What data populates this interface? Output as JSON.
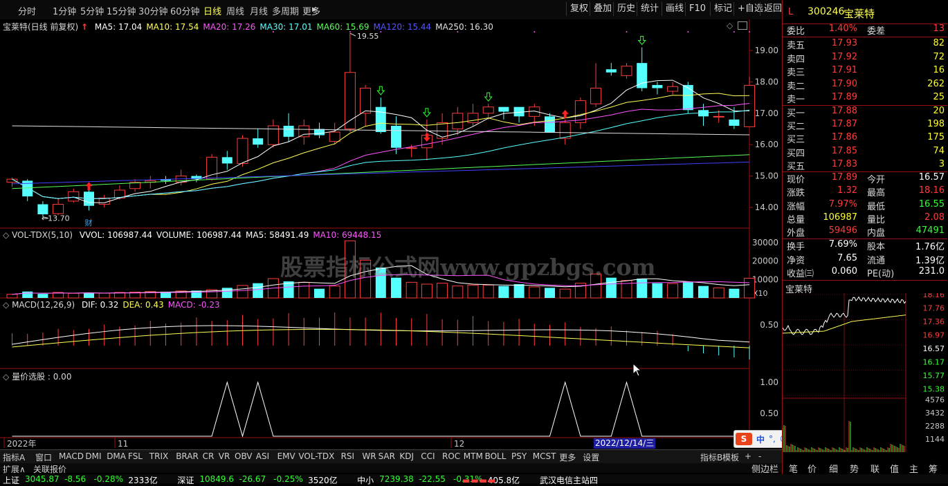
{
  "periods": [
    "分时",
    "1分钟",
    "5分钟",
    "15分钟",
    "30分钟",
    "60分钟",
    "日线",
    "周线",
    "月线",
    "多周期",
    "更多"
  ],
  "active_period": "日线",
  "toolbar_right": [
    "复权",
    "叠加",
    "历史",
    "统计",
    "画线",
    "F10",
    "标记",
    "+自选",
    "返回"
  ],
  "stock": {
    "code": "300246",
    "name": "宝莱特",
    "prefix": "L"
  },
  "ma_line": {
    "title": "宝莱特(日线 前复权)",
    "items": [
      {
        "label": "MA5: 17.04",
        "color": "#ffffff"
      },
      {
        "label": "MA10: 17.54",
        "color": "#ffff55"
      },
      {
        "label": "MA20: 17.26",
        "color": "#ff55ff"
      },
      {
        "label": "MA30: 17.01",
        "color": "#55ffff"
      },
      {
        "label": "MA60: 15.69",
        "color": "#55ff55"
      },
      {
        "label": "MA120: 15.44",
        "color": "#5555ff"
      },
      {
        "label": "MA250: 16.30",
        "color": "#e0e0e0"
      }
    ],
    "high_label": "19.55",
    "low_label": "13.70",
    "cai_label": "财"
  },
  "price_axis": [
    "19.00",
    "18.00",
    "17.00",
    "16.00",
    "15.00",
    "14.00"
  ],
  "vol_line": {
    "title": "VOL-TDX(5,10)",
    "items": [
      {
        "label": "VVOL: 106987.44",
        "color": "#ffffff"
      },
      {
        "label": "VOLUME: 106987.44",
        "color": "#ffffff"
      },
      {
        "label": "MA5: 58491.49",
        "color": "#ffffff"
      },
      {
        "label": "MA10: 69448.15",
        "color": "#ff55ff"
      }
    ]
  },
  "vol_axis": [
    "30000",
    "20000",
    "10000"
  ],
  "vol_unit": "X10",
  "macd_line": {
    "title": "MACD(12,26,9)",
    "items": [
      {
        "label": "DIF: 0.32",
        "color": "#ffffff"
      },
      {
        "label": "DEA: 0.43",
        "color": "#ffff55"
      },
      {
        "label": "MACD: -0.23",
        "color": "#ff55ff"
      }
    ]
  },
  "macd_axis": [
    "0.50"
  ],
  "lj_line": {
    "title": "量价选股 : 0.00"
  },
  "lj_axis": [
    "1.00",
    "0.50"
  ],
  "date_labels": [
    "2022年",
    "11",
    "12"
  ],
  "cursor_date": "2022/12/14/三",
  "quote": {
    "webi": {
      "label": "委比",
      "value": "1.40%",
      "label2": "委差",
      "value2": "13"
    },
    "sell": [
      {
        "label": "卖五",
        "price": "17.93",
        "vol": "82"
      },
      {
        "label": "卖四",
        "price": "17.92",
        "vol": "72"
      },
      {
        "label": "卖三",
        "price": "17.91",
        "vol": "16"
      },
      {
        "label": "卖二",
        "price": "17.90",
        "vol": "262"
      },
      {
        "label": "卖一",
        "price": "17.89",
        "vol": "25"
      }
    ],
    "buy": [
      {
        "label": "买一",
        "price": "17.88",
        "vol": "20"
      },
      {
        "label": "买二",
        "price": "17.87",
        "vol": "198"
      },
      {
        "label": "买三",
        "price": "17.86",
        "vol": "175"
      },
      {
        "label": "买四",
        "price": "17.85",
        "vol": "74"
      },
      {
        "label": "买五",
        "price": "17.83",
        "vol": "3"
      }
    ],
    "stats": [
      {
        "l1": "现价",
        "v1": "17.89",
        "c1": "red",
        "l2": "今开",
        "v2": "16.57",
        "c2": "white"
      },
      {
        "l1": "涨跌",
        "v1": "1.32",
        "c1": "red",
        "l2": "最高",
        "v2": "18.16",
        "c2": "red"
      },
      {
        "l1": "涨幅",
        "v1": "7.97%",
        "c1": "red",
        "l2": "最低",
        "v2": "16.55",
        "c2": "green"
      },
      {
        "l1": "总量",
        "v1": "106987",
        "c1": "yellow",
        "l2": "量比",
        "v2": "2.08",
        "c2": "red"
      },
      {
        "l1": "外盘",
        "v1": "59496",
        "c1": "red",
        "l2": "内盘",
        "v2": "47491",
        "c2": "green"
      }
    ],
    "fund": [
      {
        "l1": "换手",
        "v1": "7.69%",
        "l2": "股本",
        "v2": "1.76亿"
      },
      {
        "l1": "净资",
        "v1": "7.65",
        "l2": "流通",
        "v2": "1.39亿"
      },
      {
        "l1": "收益㈢",
        "v1": "0.060",
        "l2": "PE(动)",
        "v2": "231.0"
      }
    ]
  },
  "mini": {
    "title": "宝莱特",
    "axis": [
      "18.16",
      "17.76",
      "17.36",
      "16.97",
      "16.57",
      "16.17",
      "15.77",
      "15.38"
    ],
    "vol_axis": [
      "4576",
      "3432",
      "2288",
      "1144"
    ]
  },
  "indicators": [
    "指标A",
    "窗口",
    "MACD",
    "DMI",
    "DMA",
    "FSL",
    "TRIX",
    "BRAR",
    "CR",
    "VR",
    "OBV",
    "ASI",
    "EMV",
    "VOL-TDX",
    "RSI",
    "WR",
    "SAR",
    "KDJ",
    "CCI",
    "ROC",
    "MTM",
    "BOLL",
    "PSY",
    "MCST",
    "更多",
    "设置"
  ],
  "indicator_right": [
    "指标B",
    "模板",
    "+",
    "-"
  ],
  "ext_bar": [
    "扩展∧",
    "关联报价"
  ],
  "right_tabs": [
    "侧边栏",
    "笔",
    "价",
    "细",
    "势",
    "联",
    "值",
    "主",
    "筹"
  ],
  "status": [
    {
      "text": "上证",
      "color": "#ffffff"
    },
    {
      "text": "3045.87",
      "color": "#33ff33"
    },
    {
      "text": "-8.56",
      "color": "#33ff33"
    },
    {
      "text": "-0.28%",
      "color": "#33ff33"
    },
    {
      "text": "2333亿",
      "color": "#ffffff"
    },
    {
      "text": "深证",
      "color": "#ffffff"
    },
    {
      "text": "10849.6",
      "color": "#33ff33"
    },
    {
      "text": "-26.67",
      "color": "#33ff33"
    },
    {
      "text": "-0.25%",
      "color": "#33ff33"
    },
    {
      "text": "3520亿",
      "color": "#ffffff"
    },
    {
      "text": "中小",
      "color": "#ffffff"
    },
    {
      "text": "7239.38",
      "color": "#33ff33"
    },
    {
      "text": "-22.55",
      "color": "#33ff33"
    },
    {
      "text": "-0.31%",
      "color": "#33ff33"
    },
    {
      "text": "405.8亿",
      "color": "#ffffff"
    }
  ],
  "status_right": "武汉电信主站四",
  "watermark": "股票指标公式网www.gpzbgs.com",
  "ime_label": "中",
  "colors": {
    "up": "#ff3c3c",
    "down": "#55ffff",
    "frame": "#9a1010",
    "text_yellow": "#ffff55"
  }
}
